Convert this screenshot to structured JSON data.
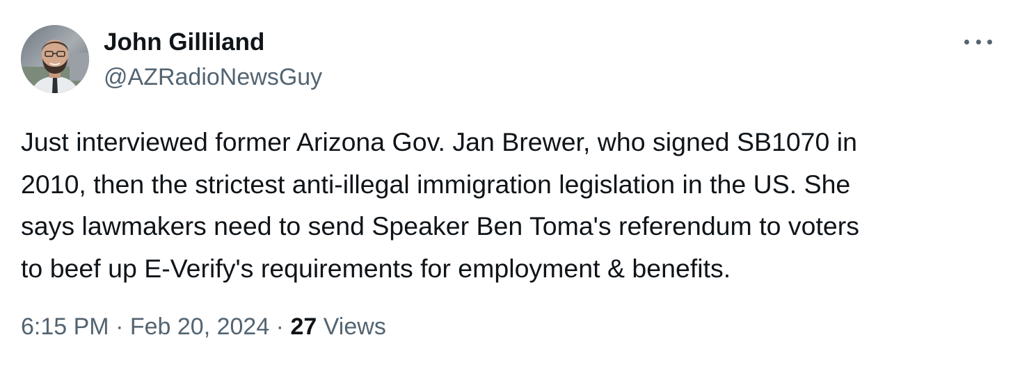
{
  "author": {
    "name": "John Gilliland",
    "handle": "@AZRadioNewsGuy"
  },
  "more_icon": "more-horizontal-icon",
  "tweet": {
    "text": "Just interviewed former Arizona Gov. Jan Brewer, who signed SB1070 in\n2010, then the strictest anti-illegal immigration legislation in the US. She\nsays lawmakers need to send Speaker Ben Toma's referendum to voters\nto beef up E-Verify's requirements for employment & benefits."
  },
  "meta": {
    "time": "6:15 PM",
    "separator": " · ",
    "date": "Feb 20, 2024",
    "views_count": "27",
    "views_label": "Views"
  },
  "colors": {
    "text_primary": "#0f1419",
    "text_secondary": "#536471",
    "background": "#ffffff"
  }
}
